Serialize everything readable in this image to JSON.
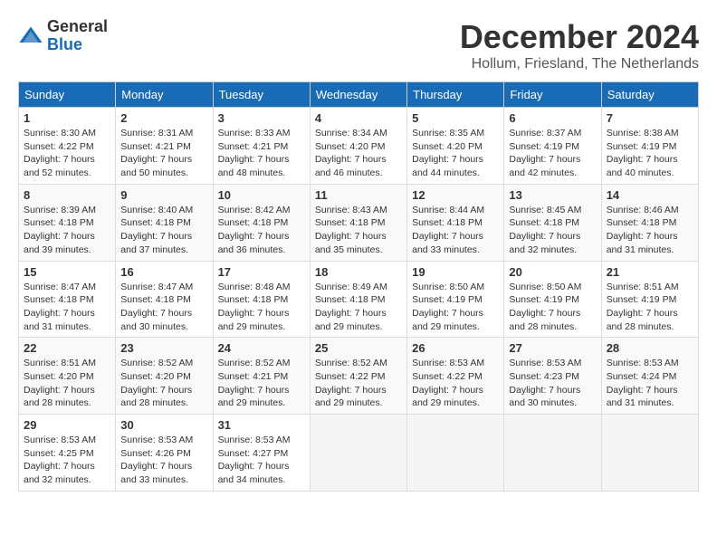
{
  "header": {
    "logo_general": "General",
    "logo_blue": "Blue",
    "month_title": "December 2024",
    "location": "Hollum, Friesland, The Netherlands"
  },
  "days_of_week": [
    "Sunday",
    "Monday",
    "Tuesday",
    "Wednesday",
    "Thursday",
    "Friday",
    "Saturday"
  ],
  "weeks": [
    [
      {
        "day": "1",
        "sunrise": "8:30 AM",
        "sunset": "4:22 PM",
        "daylight": "7 hours and 52 minutes."
      },
      {
        "day": "2",
        "sunrise": "8:31 AM",
        "sunset": "4:21 PM",
        "daylight": "7 hours and 50 minutes."
      },
      {
        "day": "3",
        "sunrise": "8:33 AM",
        "sunset": "4:21 PM",
        "daylight": "7 hours and 48 minutes."
      },
      {
        "day": "4",
        "sunrise": "8:34 AM",
        "sunset": "4:20 PM",
        "daylight": "7 hours and 46 minutes."
      },
      {
        "day": "5",
        "sunrise": "8:35 AM",
        "sunset": "4:20 PM",
        "daylight": "7 hours and 44 minutes."
      },
      {
        "day": "6",
        "sunrise": "8:37 AM",
        "sunset": "4:19 PM",
        "daylight": "7 hours and 42 minutes."
      },
      {
        "day": "7",
        "sunrise": "8:38 AM",
        "sunset": "4:19 PM",
        "daylight": "7 hours and 40 minutes."
      }
    ],
    [
      {
        "day": "8",
        "sunrise": "8:39 AM",
        "sunset": "4:18 PM",
        "daylight": "7 hours and 39 minutes."
      },
      {
        "day": "9",
        "sunrise": "8:40 AM",
        "sunset": "4:18 PM",
        "daylight": "7 hours and 37 minutes."
      },
      {
        "day": "10",
        "sunrise": "8:42 AM",
        "sunset": "4:18 PM",
        "daylight": "7 hours and 36 minutes."
      },
      {
        "day": "11",
        "sunrise": "8:43 AM",
        "sunset": "4:18 PM",
        "daylight": "7 hours and 35 minutes."
      },
      {
        "day": "12",
        "sunrise": "8:44 AM",
        "sunset": "4:18 PM",
        "daylight": "7 hours and 33 minutes."
      },
      {
        "day": "13",
        "sunrise": "8:45 AM",
        "sunset": "4:18 PM",
        "daylight": "7 hours and 32 minutes."
      },
      {
        "day": "14",
        "sunrise": "8:46 AM",
        "sunset": "4:18 PM",
        "daylight": "7 hours and 31 minutes."
      }
    ],
    [
      {
        "day": "15",
        "sunrise": "8:47 AM",
        "sunset": "4:18 PM",
        "daylight": "7 hours and 31 minutes."
      },
      {
        "day": "16",
        "sunrise": "8:47 AM",
        "sunset": "4:18 PM",
        "daylight": "7 hours and 30 minutes."
      },
      {
        "day": "17",
        "sunrise": "8:48 AM",
        "sunset": "4:18 PM",
        "daylight": "7 hours and 29 minutes."
      },
      {
        "day": "18",
        "sunrise": "8:49 AM",
        "sunset": "4:18 PM",
        "daylight": "7 hours and 29 minutes."
      },
      {
        "day": "19",
        "sunrise": "8:50 AM",
        "sunset": "4:19 PM",
        "daylight": "7 hours and 29 minutes."
      },
      {
        "day": "20",
        "sunrise": "8:50 AM",
        "sunset": "4:19 PM",
        "daylight": "7 hours and 28 minutes."
      },
      {
        "day": "21",
        "sunrise": "8:51 AM",
        "sunset": "4:19 PM",
        "daylight": "7 hours and 28 minutes."
      }
    ],
    [
      {
        "day": "22",
        "sunrise": "8:51 AM",
        "sunset": "4:20 PM",
        "daylight": "7 hours and 28 minutes."
      },
      {
        "day": "23",
        "sunrise": "8:52 AM",
        "sunset": "4:20 PM",
        "daylight": "7 hours and 28 minutes."
      },
      {
        "day": "24",
        "sunrise": "8:52 AM",
        "sunset": "4:21 PM",
        "daylight": "7 hours and 29 minutes."
      },
      {
        "day": "25",
        "sunrise": "8:52 AM",
        "sunset": "4:22 PM",
        "daylight": "7 hours and 29 minutes."
      },
      {
        "day": "26",
        "sunrise": "8:53 AM",
        "sunset": "4:22 PM",
        "daylight": "7 hours and 29 minutes."
      },
      {
        "day": "27",
        "sunrise": "8:53 AM",
        "sunset": "4:23 PM",
        "daylight": "7 hours and 30 minutes."
      },
      {
        "day": "28",
        "sunrise": "8:53 AM",
        "sunset": "4:24 PM",
        "daylight": "7 hours and 31 minutes."
      }
    ],
    [
      {
        "day": "29",
        "sunrise": "8:53 AM",
        "sunset": "4:25 PM",
        "daylight": "7 hours and 32 minutes."
      },
      {
        "day": "30",
        "sunrise": "8:53 AM",
        "sunset": "4:26 PM",
        "daylight": "7 hours and 33 minutes."
      },
      {
        "day": "31",
        "sunrise": "8:53 AM",
        "sunset": "4:27 PM",
        "daylight": "7 hours and 34 minutes."
      },
      null,
      null,
      null,
      null
    ]
  ]
}
